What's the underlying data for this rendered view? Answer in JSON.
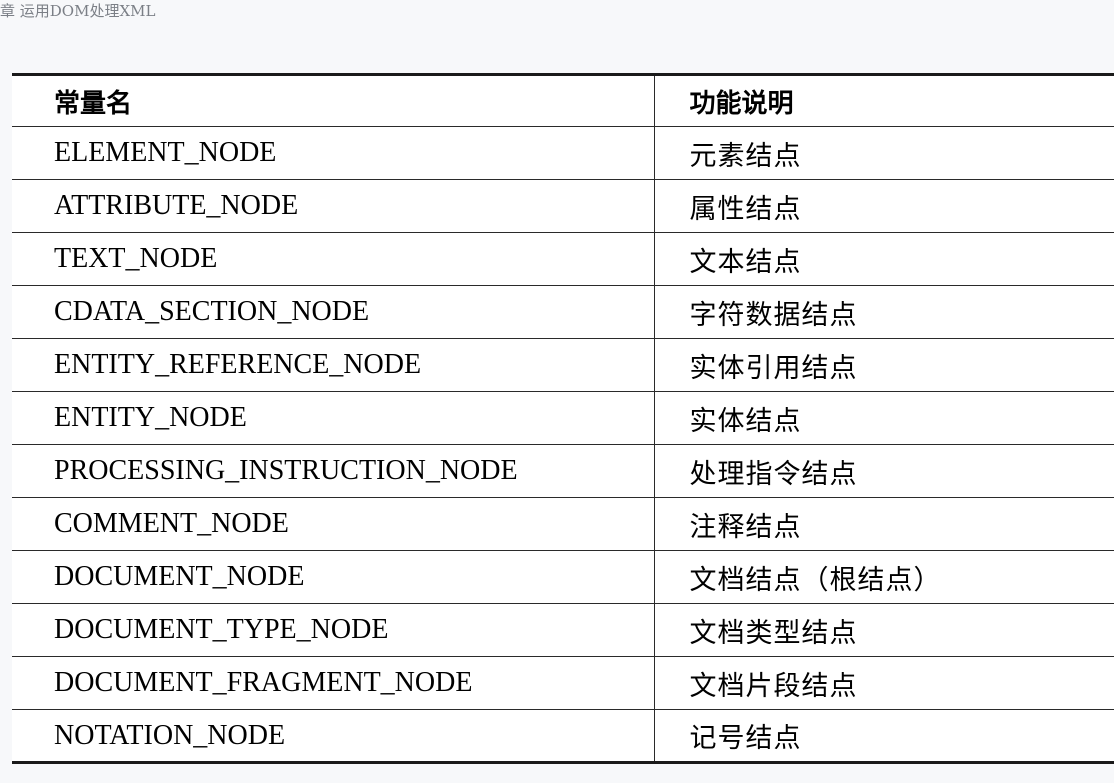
{
  "running_header": "章 运用DOM处理XML",
  "table": {
    "headers": [
      "常量名",
      "功能说明"
    ],
    "rows": [
      [
        "ELEMENT_NODE",
        "元素结点"
      ],
      [
        "ATTRIBUTE_NODE",
        "属性结点"
      ],
      [
        "TEXT_NODE",
        "文本结点"
      ],
      [
        "CDATA_SECTION_NODE",
        "字符数据结点"
      ],
      [
        "ENTITY_REFERENCE_NODE",
        "实体引用结点"
      ],
      [
        "ENTITY_NODE",
        "实体结点"
      ],
      [
        "PROCESSING_INSTRUCTION_NODE",
        "处理指令结点"
      ],
      [
        "COMMENT_NODE",
        "注释结点"
      ],
      [
        "DOCUMENT_NODE",
        "文档结点（根结点）"
      ],
      [
        "DOCUMENT_TYPE_NODE",
        "文档类型结点"
      ],
      [
        "DOCUMENT_FRAGMENT_NODE",
        "文档片段结点"
      ],
      [
        "NOTATION_NODE",
        "记号结点"
      ]
    ]
  }
}
